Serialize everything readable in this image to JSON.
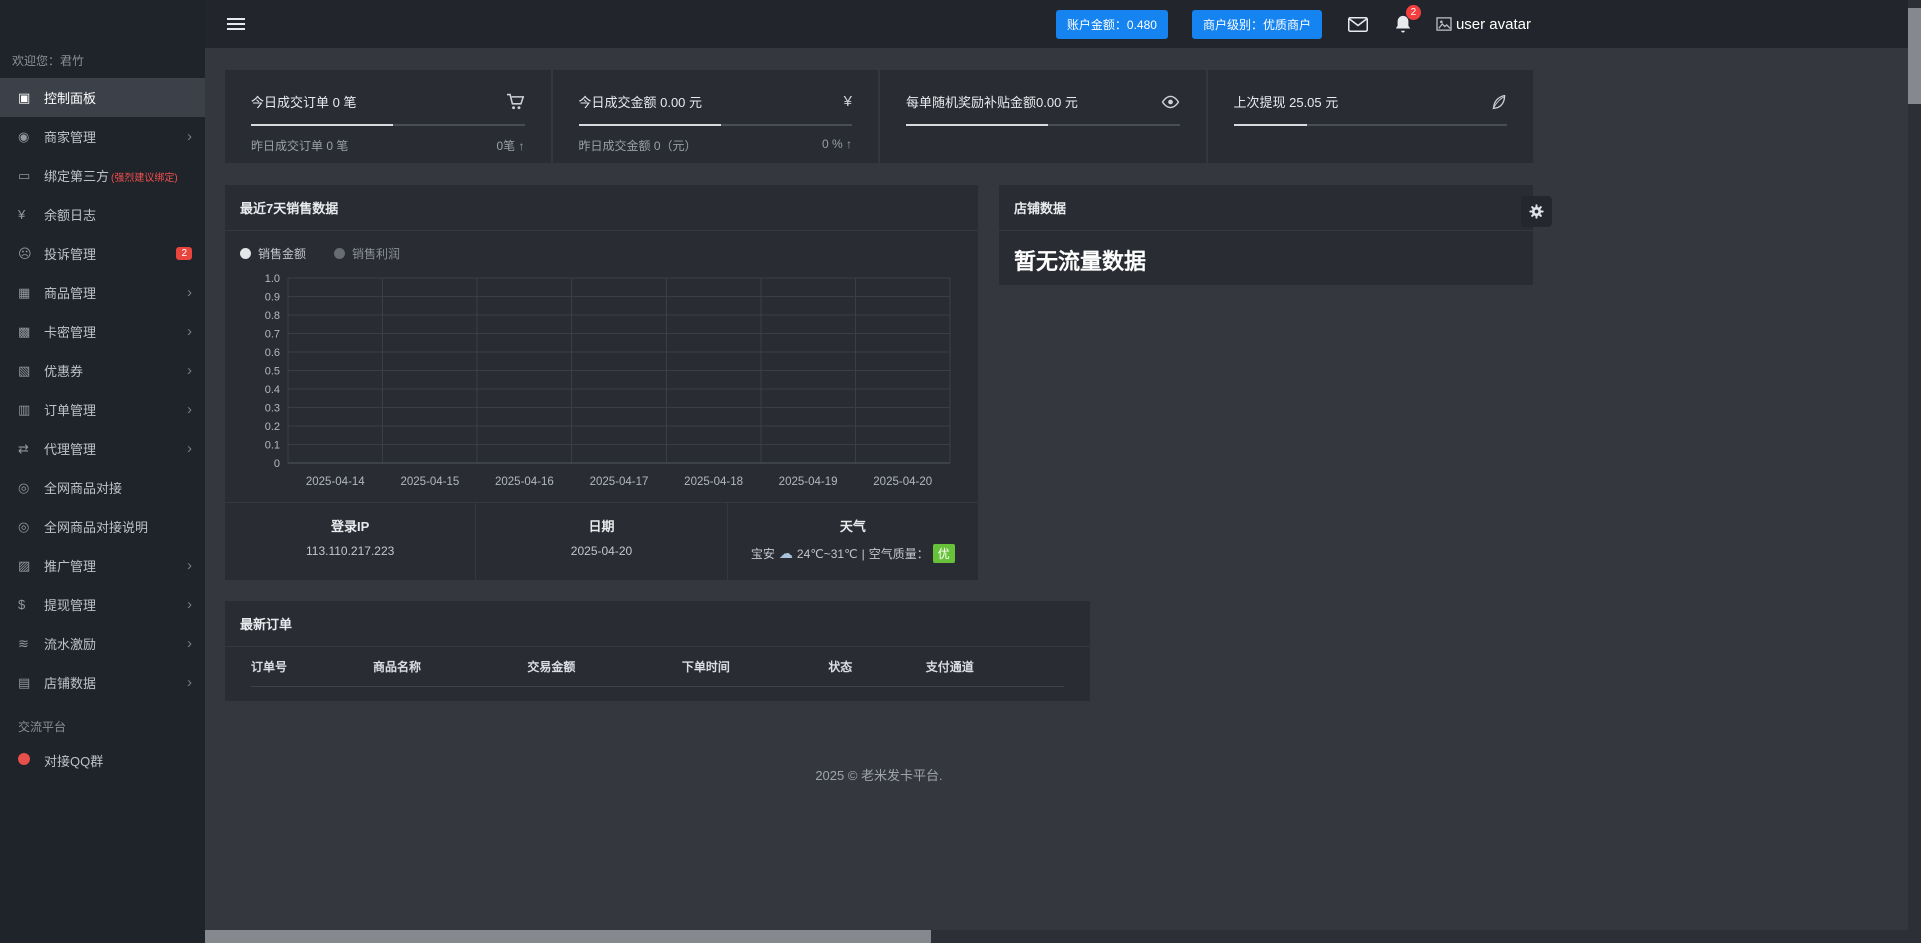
{
  "app": {
    "footer": "2025 © 老米发卡平台.",
    "accent_blue": "#1583f0",
    "badge_red": "#e8453f",
    "badge_green": "#67c23a"
  },
  "icons": {
    "chevron_right": "›",
    "yen": "¥",
    "cloud": "☁"
  },
  "topbar": {
    "balance_button": "账户金额：0.480",
    "level_button": "商户级别：优质商户",
    "notification_count": "2",
    "avatar_alt": "user avatar"
  },
  "sidebar": {
    "welcome": "欢迎您：君竹",
    "items": [
      {
        "label": "控制面板",
        "icon": "dashboard-icon",
        "glyph": "▣",
        "active": true
      },
      {
        "label": "商家管理",
        "icon": "merchant-icon",
        "glyph": "◉",
        "chevron": true
      },
      {
        "label": "绑定第三方",
        "suffix": "(强烈建议绑定)",
        "icon": "bind-third-party-icon",
        "glyph": "▭"
      },
      {
        "label": "余额日志",
        "icon": "balance-log-icon",
        "glyph": "¥"
      },
      {
        "label": "投诉管理",
        "icon": "complaint-icon",
        "glyph": "☹",
        "badge": "2"
      },
      {
        "label": "商品管理",
        "icon": "product-icon",
        "glyph": "▦",
        "chevron": true
      },
      {
        "label": "卡密管理",
        "icon": "card-key-icon",
        "glyph": "▩",
        "chevron": true
      },
      {
        "label": "优惠券",
        "icon": "coupon-icon",
        "glyph": "▧",
        "chevron": true
      },
      {
        "label": "订单管理",
        "icon": "order-icon",
        "glyph": "▥",
        "chevron": true
      },
      {
        "label": "代理管理",
        "icon": "agent-icon",
        "glyph": "⇄",
        "chevron": true
      },
      {
        "label": "全网商品对接",
        "icon": "network-product-icon",
        "glyph": "◎"
      },
      {
        "label": "全网商品对接说明",
        "icon": "network-product-doc-icon",
        "glyph": "◎"
      },
      {
        "label": "推广管理",
        "icon": "promotion-icon",
        "glyph": "▨",
        "chevron": true
      },
      {
        "label": "提现管理",
        "icon": "withdraw-icon",
        "glyph": "$",
        "chevron": true
      },
      {
        "label": "流水激励",
        "icon": "flow-reward-icon",
        "glyph": "≋",
        "chevron": true
      },
      {
        "label": "店铺数据",
        "icon": "shop-data-icon",
        "glyph": "▤",
        "chevron": true
      }
    ],
    "section_title": "交流平台",
    "qq_item": {
      "label": "对接QQ群",
      "icon": "qq-icon"
    }
  },
  "stats": [
    {
      "title": "今日成交订单 0 笔",
      "icon": "cart-icon",
      "progress": 52,
      "sub_left": "昨日成交订单 0 笔",
      "sub_right": "0笔 ↑"
    },
    {
      "title": "今日成交金额 0.00 元",
      "icon": "yen-icon",
      "progress": 52,
      "sub_left": "昨日成交金额 0（元）",
      "sub_right": "0 % ↑"
    },
    {
      "title": "每单随机奖励补贴金额0.00 元",
      "icon": "eye-icon",
      "progress": 52,
      "sub_left": "",
      "sub_right": ""
    },
    {
      "title": "上次提现 25.05 元",
      "icon": "quill-icon",
      "progress": 27,
      "sub_left": "",
      "sub_right": ""
    }
  ],
  "chart_data": {
    "type": "line",
    "title": "最近7天销售数据",
    "legend": [
      {
        "name": "销售金额",
        "selected": true
      },
      {
        "name": "销售利润",
        "selected": false
      }
    ],
    "legend_position": "top-left",
    "x": [
      "2025-04-14",
      "2025-04-15",
      "2025-04-16",
      "2025-04-17",
      "2025-04-18",
      "2025-04-19",
      "2025-04-20"
    ],
    "series": [
      {
        "name": "销售金额",
        "values": [
          0,
          0,
          0,
          0,
          0,
          0,
          0
        ]
      },
      {
        "name": "销售利润",
        "values": [
          0,
          0,
          0,
          0,
          0,
          0,
          0
        ]
      }
    ],
    "ylim": [
      0,
      1.0
    ],
    "yticks": [
      "1.0",
      "0.9",
      "0.8",
      "0.7",
      "0.6",
      "0.5",
      "0.4",
      "0.3",
      "0.2",
      "0.1",
      "0"
    ],
    "grid": true
  },
  "info_row": {
    "columns": [
      {
        "title": "登录IP",
        "value": "113.110.217.223"
      },
      {
        "title": "日期",
        "value": "2025-04-20"
      },
      {
        "title": "天气",
        "city": "宝安",
        "temp": "24℃~31℃",
        "sep": "|",
        "air_label": "空气质量：",
        "air_value": "优"
      }
    ]
  },
  "store_card": {
    "title": "店铺数据",
    "empty_text": "暂无流量数据"
  },
  "orders_card": {
    "title": "最新订单",
    "headers": [
      "订单号",
      "商品名称",
      "交易金额",
      "下单时间",
      "状态",
      "支付通道"
    ],
    "rows": []
  }
}
